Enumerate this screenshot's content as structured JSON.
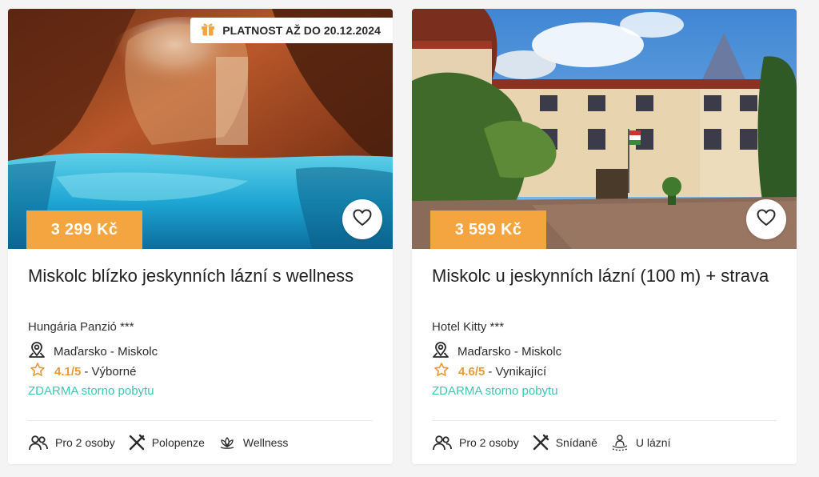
{
  "cards": [
    {
      "validity": "PLATNOST AŽ DO 20.12.2024",
      "price": "3 299 Kč",
      "title": "Miskolc blízko jeskynních lázní s wellness",
      "hotel": "Hungária Panzió ***",
      "location": "Maďarsko - Miskolc",
      "rating_score": "4.1/5",
      "rating_label": "- Výborné",
      "storno": "ZDARMA storno pobytu",
      "features": [
        {
          "icon": "people-icon",
          "label": "Pro 2 osoby"
        },
        {
          "icon": "cutlery-icon",
          "label": "Polopenze"
        },
        {
          "icon": "lotus-icon",
          "label": "Wellness"
        }
      ]
    },
    {
      "price": "3 599 Kč",
      "title": "Miskolc u jeskynních lázní (100 m) + strava",
      "hotel": "Hotel Kitty ***",
      "location": "Maďarsko - Miskolc",
      "rating_score": "4.6/5",
      "rating_label": "- Vynikající",
      "storno": "ZDARMA storno pobytu",
      "features": [
        {
          "icon": "people-icon",
          "label": "Pro 2 osoby"
        },
        {
          "icon": "cutlery-icon",
          "label": "Snídaně"
        },
        {
          "icon": "spa-bath-icon",
          "label": "U lázní"
        }
      ]
    }
  ],
  "colors": {
    "price_badge": "#f4a53f",
    "rating": "#e89a34",
    "storno": "#3dc7b5",
    "gift": "#f4a53f"
  }
}
